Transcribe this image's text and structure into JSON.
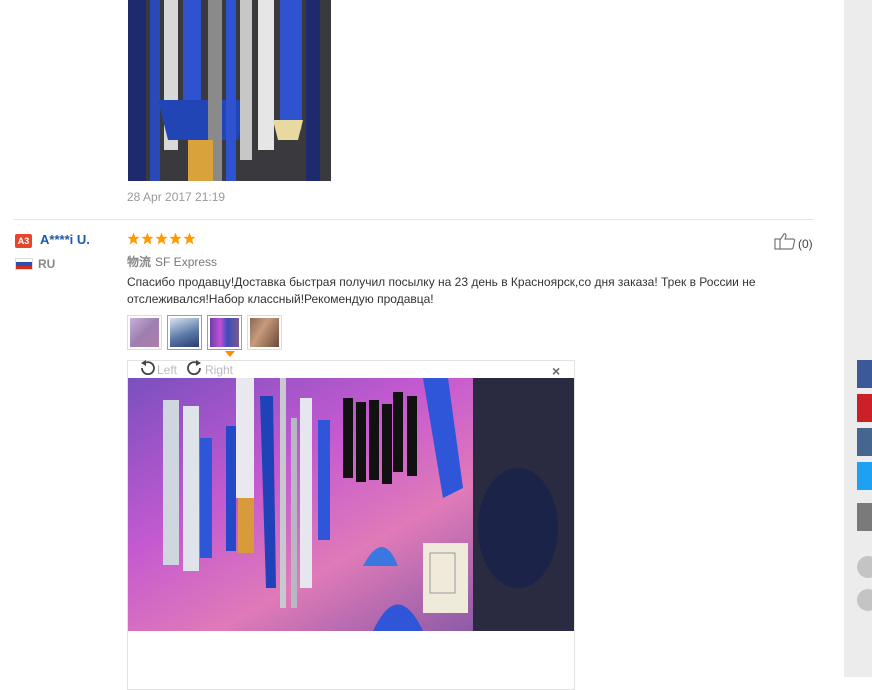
{
  "previous_review": {
    "date": "28 Apr 2017 21:19"
  },
  "review": {
    "reviewer_badge": "A3",
    "reviewer_name": "A****i U.",
    "country_code": "RU",
    "rating": 5,
    "shipping_label": "物流",
    "shipping_method": "SF Express",
    "text": "Спасибо продавцу!Доставка быстрая получил посылку на 23 день в Красноярск,со дня заказа! Трек в России не отслеживался!Набор классный!Рекомендую продавца!",
    "helpful_count": "(0)",
    "thumbnails": 4,
    "selected_thumbnail": 3
  },
  "viewer": {
    "rotate_left_label": "Left",
    "rotate_right_label": "Right",
    "close_label": "×"
  },
  "colors": {
    "star": "#ff9a00",
    "name_link": "#1b5aa8",
    "badge": "#e8462b",
    "selected_thumb_border": "#ff8a00"
  },
  "share": {
    "icons": [
      "facebook-icon",
      "pinterest-icon",
      "vk-icon",
      "twitter-icon",
      "more-icon"
    ]
  }
}
